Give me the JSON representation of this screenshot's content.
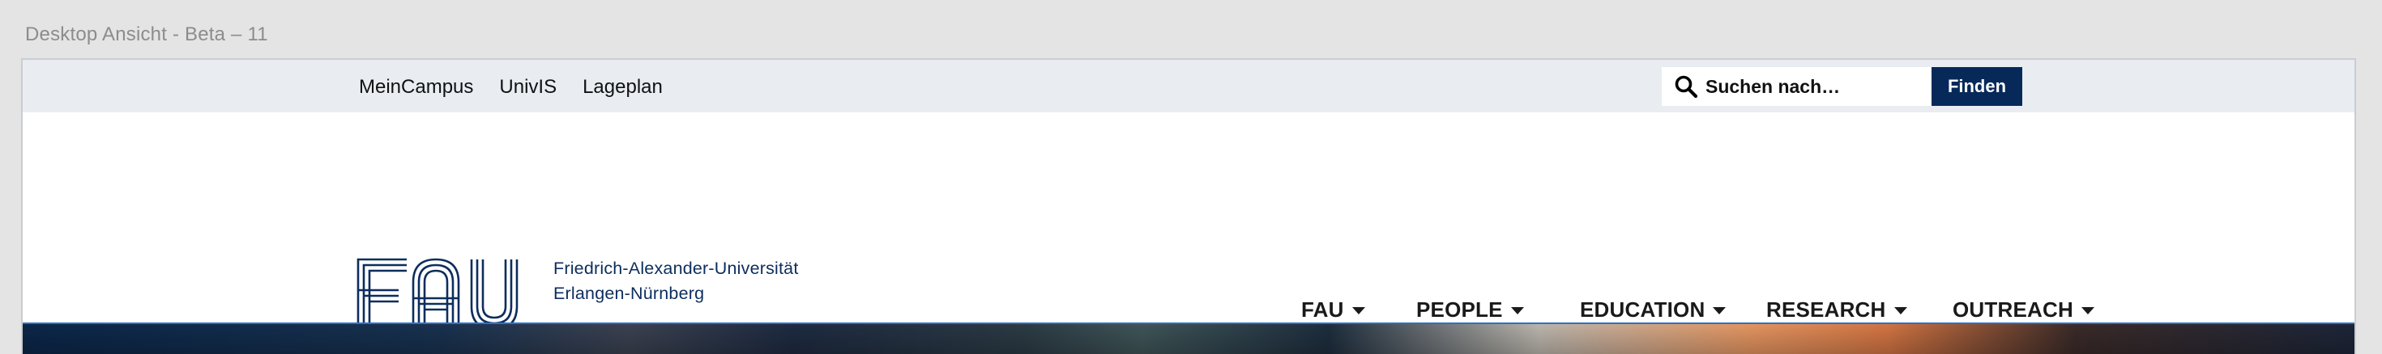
{
  "canvas": {
    "title": "Desktop Ansicht - Beta – 11"
  },
  "topbar": {
    "links": [
      "MeinCampus",
      "UnivIS",
      "Lageplan"
    ],
    "search": {
      "placeholder": "Suchen nach…",
      "value": ""
    },
    "find_label": "Finden"
  },
  "logo": {
    "mark_text": "FAU",
    "line1": "Friedrich-Alexander-Universität",
    "line2": "Erlangen-Nürnberg"
  },
  "nav": {
    "items": [
      {
        "label": "FAU"
      },
      {
        "label": "PEOPLE"
      },
      {
        "label": "EDUCATION"
      },
      {
        "label": "RESEARCH"
      },
      {
        "label": "OUTREACH"
      }
    ]
  },
  "colors": {
    "brand": "#06295a",
    "topbar_bg": "#e9edf1",
    "logo_text": "#0c2d5d",
    "nav_text": "#1a1a1a",
    "hero_border": "#2e6fc6"
  },
  "icons": {
    "search": "search-icon",
    "caret": "caret-down-icon",
    "logo": "fau-logo"
  }
}
